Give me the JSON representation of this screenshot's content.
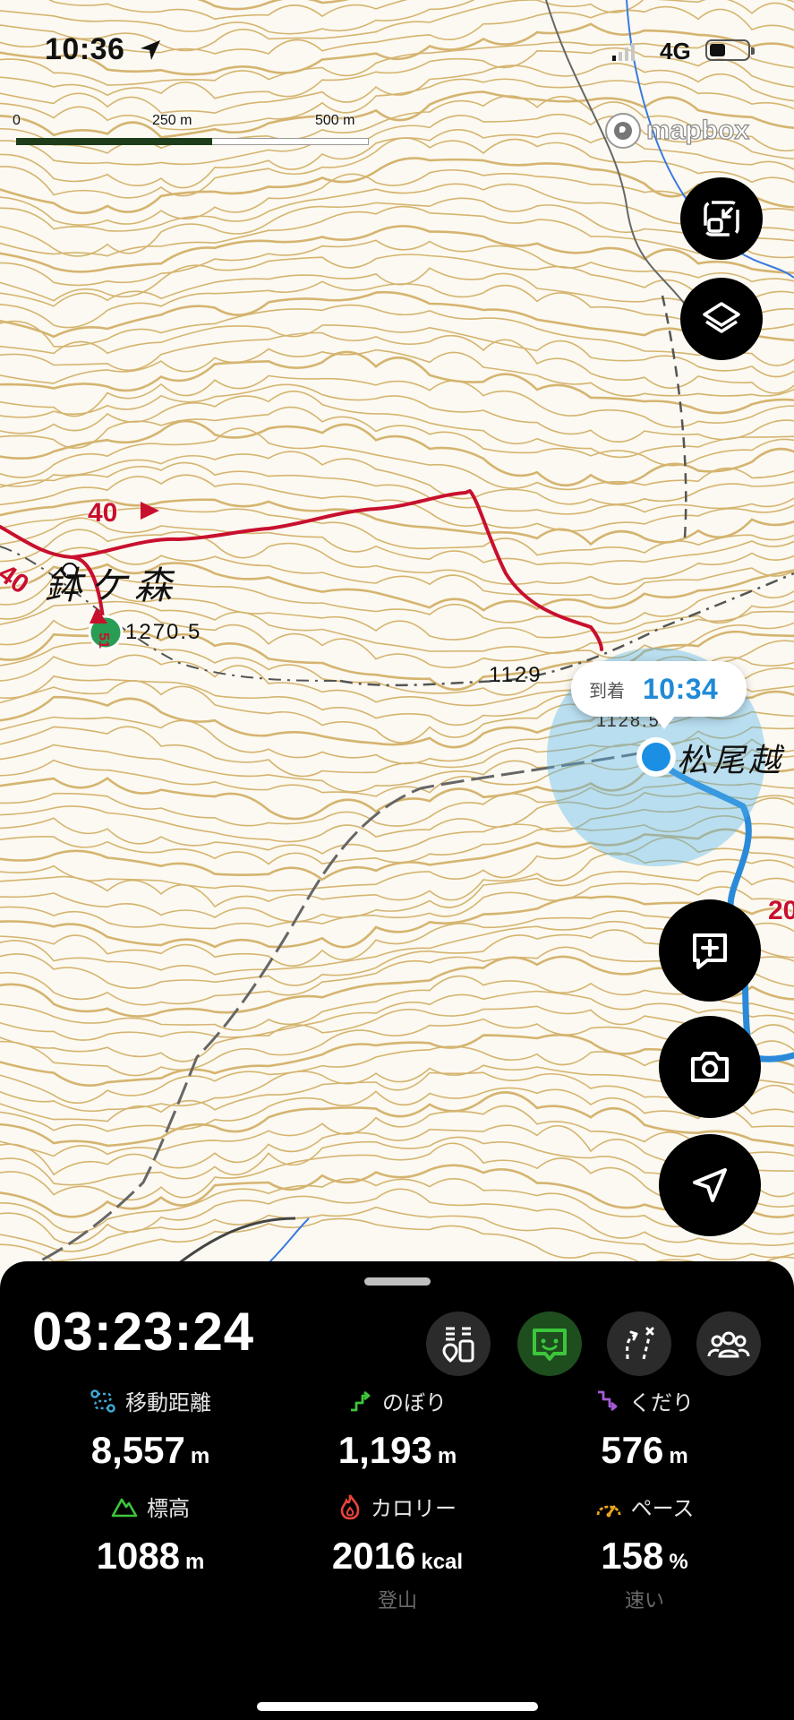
{
  "status_bar": {
    "time": "10:36",
    "network": "4G"
  },
  "scale_bar": {
    "labels": [
      "0",
      "250 m",
      "500 m"
    ]
  },
  "attribution": "mapbox",
  "map": {
    "labels": {
      "peak_name": "鉢ケ森",
      "peak_elevation": "1270.5",
      "contour_value": "1129",
      "pass_name": "松尾越",
      "triangulation": "1128.5",
      "route_marker_a": "40",
      "route_marker_b": "40",
      "route_marker_c": "20",
      "waypoint_badge": "51"
    }
  },
  "callout": {
    "label": "到着",
    "time": "10:34"
  },
  "panel": {
    "elapsed_time": "03:23:24",
    "stats": [
      {
        "label": "移動距離",
        "value": "8,557",
        "unit": "m",
        "sub": ""
      },
      {
        "label": "のぼり",
        "value": "1,193",
        "unit": "m",
        "sub": ""
      },
      {
        "label": "くだり",
        "value": "576",
        "unit": "m",
        "sub": ""
      },
      {
        "label": "標高",
        "value": "1088",
        "unit": "m",
        "sub": ""
      },
      {
        "label": "カロリー",
        "value": "2016",
        "unit": "kcal",
        "sub": "登山"
      },
      {
        "label": "ペース",
        "value": "158",
        "unit": "%",
        "sub": "速い"
      }
    ]
  },
  "colors": {
    "route_past": "#c8102e",
    "route_planned": "#2a8ad9",
    "contour": "#c9a253",
    "accent_green": "#3cc63c",
    "location": "#1a8fe3"
  }
}
